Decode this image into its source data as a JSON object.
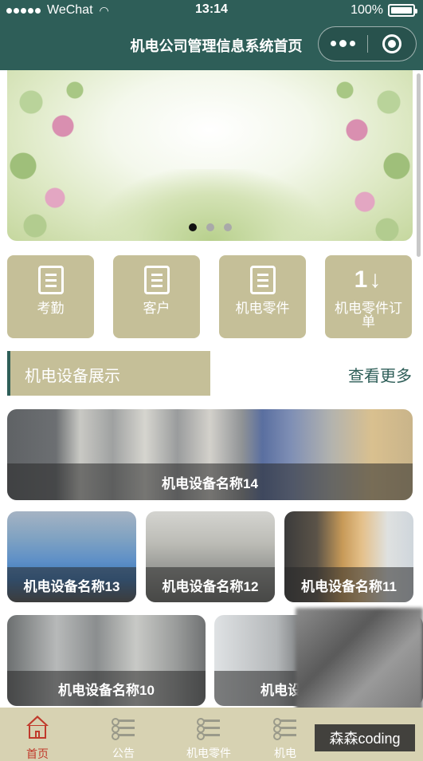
{
  "status_bar": {
    "carrier": "WeChat",
    "time": "13:14",
    "battery": "100%"
  },
  "nav": {
    "title": "机电公司管理信息系统首页"
  },
  "banner": {
    "slide_count": 3,
    "active_slide": 1
  },
  "menu": {
    "items": [
      {
        "label": "考勤",
        "icon": "document-icon"
      },
      {
        "label": "客户",
        "icon": "document-icon"
      },
      {
        "label": "机电零件",
        "icon": "document-icon"
      },
      {
        "label": "机电零件订单",
        "icon": "sort-arrows-icon"
      }
    ]
  },
  "section": {
    "title": "机电设备展示",
    "more_label": "查看更多"
  },
  "devices": [
    {
      "name": "机电设备名称14"
    },
    {
      "name": "机电设备名称13"
    },
    {
      "name": "机电设备名称12"
    },
    {
      "name": "机电设备名称11"
    },
    {
      "name": "机电设备名称10"
    },
    {
      "name": "机电设"
    }
  ],
  "tabbar": {
    "items": [
      {
        "label": "首页",
        "icon": "home-icon",
        "active": true
      },
      {
        "label": "公告",
        "icon": "list-icon",
        "active": false
      },
      {
        "label": "机电零件",
        "icon": "list-icon",
        "active": false
      },
      {
        "label": "机电",
        "icon": "list-icon",
        "active": false
      }
    ]
  },
  "watermark": "森森coding",
  "colors": {
    "header_bg": "#2e5e58",
    "accent_khaki": "#c5bf98",
    "tabbar_bg": "#d7d2b2",
    "active_red": "#c0392b"
  }
}
